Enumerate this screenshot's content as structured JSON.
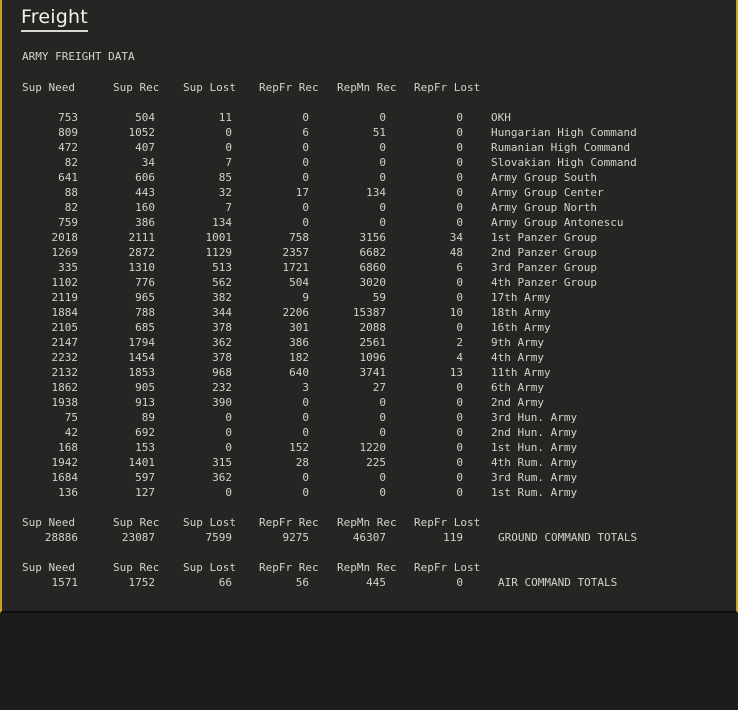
{
  "window": {
    "title": "Freight"
  },
  "report": {
    "heading": "ARMY FREIGHT DATA",
    "columns": [
      "Sup Need",
      "Sup Rec",
      "Sup Lost",
      "RepFr Rec",
      "RepMn Rec",
      "RepFr Lost"
    ],
    "rows": [
      {
        "sup_need": "753",
        "sup_rec": "504",
        "sup_lost": "11",
        "repfr_rec": "0",
        "repmn_rec": "0",
        "repfr_lost": "0",
        "name": "OKH"
      },
      {
        "sup_need": "809",
        "sup_rec": "1052",
        "sup_lost": "0",
        "repfr_rec": "6",
        "repmn_rec": "51",
        "repfr_lost": "0",
        "name": "Hungarian High Command"
      },
      {
        "sup_need": "472",
        "sup_rec": "407",
        "sup_lost": "0",
        "repfr_rec": "0",
        "repmn_rec": "0",
        "repfr_lost": "0",
        "name": "Rumanian High Command"
      },
      {
        "sup_need": "82",
        "sup_rec": "34",
        "sup_lost": "7",
        "repfr_rec": "0",
        "repmn_rec": "0",
        "repfr_lost": "0",
        "name": "Slovakian High Command"
      },
      {
        "sup_need": "641",
        "sup_rec": "606",
        "sup_lost": "85",
        "repfr_rec": "0",
        "repmn_rec": "0",
        "repfr_lost": "0",
        "name": "Army Group South"
      },
      {
        "sup_need": "88",
        "sup_rec": "443",
        "sup_lost": "32",
        "repfr_rec": "17",
        "repmn_rec": "134",
        "repfr_lost": "0",
        "name": "Army Group Center"
      },
      {
        "sup_need": "82",
        "sup_rec": "160",
        "sup_lost": "7",
        "repfr_rec": "0",
        "repmn_rec": "0",
        "repfr_lost": "0",
        "name": "Army Group North"
      },
      {
        "sup_need": "759",
        "sup_rec": "386",
        "sup_lost": "134",
        "repfr_rec": "0",
        "repmn_rec": "0",
        "repfr_lost": "0",
        "name": "Army Group Antonescu"
      },
      {
        "sup_need": "2018",
        "sup_rec": "2111",
        "sup_lost": "1001",
        "repfr_rec": "758",
        "repmn_rec": "3156",
        "repfr_lost": "34",
        "name": "1st Panzer Group"
      },
      {
        "sup_need": "1269",
        "sup_rec": "2872",
        "sup_lost": "1129",
        "repfr_rec": "2357",
        "repmn_rec": "6682",
        "repfr_lost": "48",
        "name": "2nd Panzer Group"
      },
      {
        "sup_need": "335",
        "sup_rec": "1310",
        "sup_lost": "513",
        "repfr_rec": "1721",
        "repmn_rec": "6860",
        "repfr_lost": "6",
        "name": "3rd Panzer Group"
      },
      {
        "sup_need": "1102",
        "sup_rec": "776",
        "sup_lost": "562",
        "repfr_rec": "504",
        "repmn_rec": "3020",
        "repfr_lost": "0",
        "name": "4th Panzer Group"
      },
      {
        "sup_need": "2119",
        "sup_rec": "965",
        "sup_lost": "382",
        "repfr_rec": "9",
        "repmn_rec": "59",
        "repfr_lost": "0",
        "name": "17th Army"
      },
      {
        "sup_need": "1884",
        "sup_rec": "788",
        "sup_lost": "344",
        "repfr_rec": "2206",
        "repmn_rec": "15387",
        "repfr_lost": "10",
        "name": "18th Army"
      },
      {
        "sup_need": "2105",
        "sup_rec": "685",
        "sup_lost": "378",
        "repfr_rec": "301",
        "repmn_rec": "2088",
        "repfr_lost": "0",
        "name": "16th Army"
      },
      {
        "sup_need": "2147",
        "sup_rec": "1794",
        "sup_lost": "362",
        "repfr_rec": "386",
        "repmn_rec": "2561",
        "repfr_lost": "2",
        "name": "9th Army"
      },
      {
        "sup_need": "2232",
        "sup_rec": "1454",
        "sup_lost": "378",
        "repfr_rec": "182",
        "repmn_rec": "1096",
        "repfr_lost": "4",
        "name": "4th Army"
      },
      {
        "sup_need": "2132",
        "sup_rec": "1853",
        "sup_lost": "968",
        "repfr_rec": "640",
        "repmn_rec": "3741",
        "repfr_lost": "13",
        "name": "11th Army"
      },
      {
        "sup_need": "1862",
        "sup_rec": "905",
        "sup_lost": "232",
        "repfr_rec": "3",
        "repmn_rec": "27",
        "repfr_lost": "0",
        "name": "6th Army"
      },
      {
        "sup_need": "1938",
        "sup_rec": "913",
        "sup_lost": "390",
        "repfr_rec": "0",
        "repmn_rec": "0",
        "repfr_lost": "0",
        "name": "2nd Army"
      },
      {
        "sup_need": "75",
        "sup_rec": "89",
        "sup_lost": "0",
        "repfr_rec": "0",
        "repmn_rec": "0",
        "repfr_lost": "0",
        "name": "3rd Hun. Army"
      },
      {
        "sup_need": "42",
        "sup_rec": "692",
        "sup_lost": "0",
        "repfr_rec": "0",
        "repmn_rec": "0",
        "repfr_lost": "0",
        "name": "2nd Hun. Army"
      },
      {
        "sup_need": "168",
        "sup_rec": "153",
        "sup_lost": "0",
        "repfr_rec": "152",
        "repmn_rec": "1220",
        "repfr_lost": "0",
        "name": "1st Hun. Army"
      },
      {
        "sup_need": "1942",
        "sup_rec": "1401",
        "sup_lost": "315",
        "repfr_rec": "28",
        "repmn_rec": "225",
        "repfr_lost": "0",
        "name": "4th Rum. Army"
      },
      {
        "sup_need": "1684",
        "sup_rec": "597",
        "sup_lost": "362",
        "repfr_rec": "0",
        "repmn_rec": "0",
        "repfr_lost": "0",
        "name": "3rd Rum. Army"
      },
      {
        "sup_need": "136",
        "sup_rec": "127",
        "sup_lost": "0",
        "repfr_rec": "0",
        "repmn_rec": "0",
        "repfr_lost": "0",
        "name": "1st Rum. Army"
      }
    ],
    "totals": [
      {
        "sup_need": "28886",
        "sup_rec": "23087",
        "sup_lost": "7599",
        "repfr_rec": "9275",
        "repmn_rec": "46307",
        "repfr_lost": "119",
        "name": "GROUND COMMAND TOTALS"
      },
      {
        "sup_need": "1571",
        "sup_rec": "1752",
        "sup_lost": "66",
        "repfr_rec": "56",
        "repmn_rec": "445",
        "repfr_lost": "0",
        "name": "AIR COMMAND TOTALS"
      }
    ]
  }
}
